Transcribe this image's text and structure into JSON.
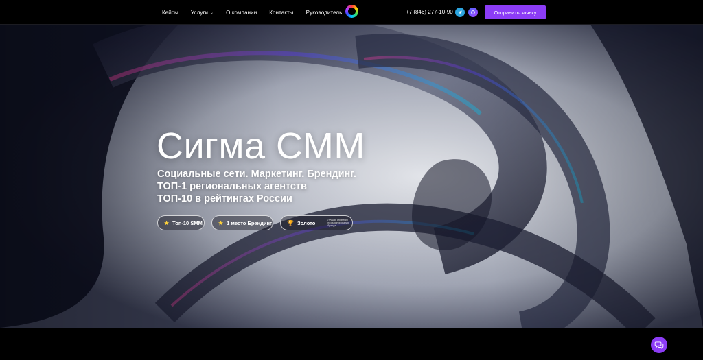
{
  "header": {
    "nav": [
      {
        "label": "Кейсы"
      },
      {
        "label": "Услуги",
        "has_dropdown": true
      },
      {
        "label": "О компании"
      },
      {
        "label": "Контакты"
      },
      {
        "label": "Руководитель"
      }
    ],
    "phone": "+7 (846) 277-10-90",
    "social": [
      {
        "icon": "telegram-icon",
        "color": "#2ca5e0"
      },
      {
        "icon": "max-messenger-icon",
        "color": "#6f52ff"
      }
    ],
    "cta_label": "Отправить заявку",
    "cta_color": "#8c3cf6"
  },
  "hero": {
    "title": "Сигма СММ",
    "subtitle_lines": [
      "Социальные сети. Маркетинг. Брендинг.",
      "ТОП-1 региональных агентств",
      "ТОП-10 в рейтингах России"
    ],
    "badges": [
      {
        "icon": "star-icon",
        "label": "Топ-10 SMM"
      },
      {
        "icon": "star-icon",
        "label": "1 место Брендинг"
      },
      {
        "icon": "trophy-icon",
        "label": "Золото",
        "note": "Лучшая стратегия позиционирования бренда"
      }
    ]
  },
  "chat": {
    "icon": "chat-bubbles-icon",
    "color": "#8c3cf6"
  }
}
